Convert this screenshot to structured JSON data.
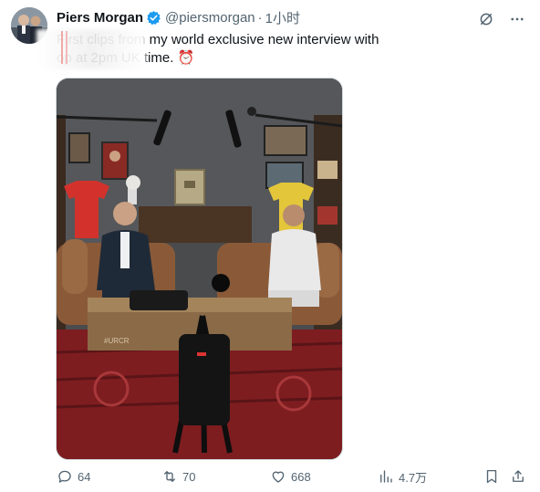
{
  "tweet": {
    "author_name": "Piers Morgan",
    "handle": "@piersmorgan",
    "separator": "·",
    "time": "1小时",
    "text_line1": "First clips from my world exclusive new interview with",
    "text_line2": "op at 2pm UK time. ⏰",
    "media_alt": "Interview set: two men seated on brown leather sofas, camera in foreground",
    "media_sign_text": "#URCR"
  },
  "actions": {
    "replies": "64",
    "retweets": "70",
    "likes": "668",
    "views": "4.7万"
  },
  "icons": {
    "verified": "verified-badge-icon",
    "grok": "grok-icon",
    "more": "more-icon",
    "reply": "reply-icon",
    "retweet": "retweet-icon",
    "like": "like-icon",
    "views": "views-icon",
    "bookmark": "bookmark-icon",
    "share": "share-icon"
  },
  "colors": {
    "verified_blue": "#1d9bf0",
    "secondary_text": "#536471",
    "primary_text": "#0f1419"
  }
}
